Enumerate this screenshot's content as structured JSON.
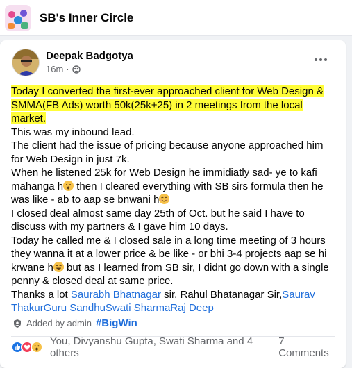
{
  "group": {
    "name": "SB's Inner Circle"
  },
  "post": {
    "author": "Deepak Badgotya",
    "time": "16m",
    "time_separator": "·",
    "highlight": "Today I converted the first-ever approached client for Web Design & SMMA(FB Ads) worth 50k(25k+25) in 2 meetings from the local market.",
    "lines": [
      "This was my inbound lead.",
      "The client had the issue of pricing because anyone approached him for Web Design in just 7k.",
      "When he listened 25k for Web Design he immidiatly sad- ye to kafi mahanga h",
      " then I cleared everything with SB sirs formula then he was like - ab to aap se bnwani h",
      "I closed deal almost same day 25th of Oct. but he said I have to discuss with my partners & I gave him 10 days.",
      "Today he called me & I closed sale in a long time meeting of 3 hours they wanna it at a lower price & be like - or bhi 3-4 projects aap se hi krwane h",
      " but as I learned from SB sir, I didnt go down with a single penny & closed deal at same price."
    ],
    "thanks_prefix": "Thanks a lot ",
    "mention_1": "Saurabh Bhatnagar",
    "thanks_middle": " sir, Rahul Bhatanagar Sir,",
    "mention_2": "Saurav ThakurGuru SandhuSwati SharmaRaj Deep"
  },
  "footer": {
    "added_by": "Added by admin",
    "hashtag": "#BigWin",
    "reactors": "You, Divyanshu Gupta, Swati Sharma and 4 others",
    "comments": "7 Comments"
  },
  "colors": {
    "highlight": "#fffd38",
    "link": "#216fdb",
    "like": "#1b74e4",
    "love": "#f33e58"
  },
  "icons": [
    "more-options-icon",
    "globe-group-icon",
    "admin-badge-icon",
    "like-reaction-icon",
    "love-reaction-icon",
    "wow-reaction-icon"
  ]
}
